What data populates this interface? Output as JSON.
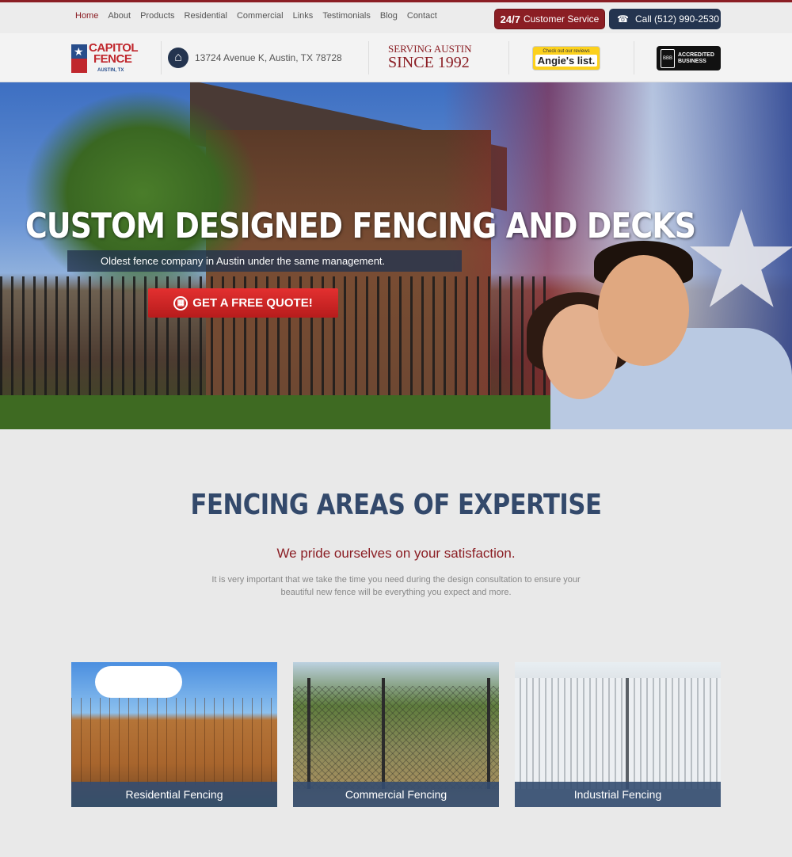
{
  "nav": {
    "items": [
      "Home",
      "About",
      "Products",
      "Residential",
      "Commercial",
      "Links",
      "Testimonials",
      "Blog",
      "Contact"
    ],
    "active": "Home"
  },
  "header": {
    "service_strong": "24/7",
    "service_label": "Customer Service",
    "call_label": "Call (512) 990-2530"
  },
  "infobar": {
    "logo_line1": "CAPITOL",
    "logo_line2": "FENCE",
    "logo_sub": "AUSTIN, TX",
    "address": "13724 Avenue K, Austin, TX 78728",
    "serving_l1": "SERVING AUSTIN",
    "serving_l2": "SINCE 1992",
    "angies_l1": "Check out our reviews",
    "angies_l2": "Angie's list.",
    "bbb_seal": "BBB",
    "bbb_text_l1": "ACCREDITED",
    "bbb_text_l2": "BUSINESS"
  },
  "hero": {
    "title": "CUSTOM DESIGNED FENCING AND DECKS",
    "subtitle": "Oldest fence company in Austin under the same management.",
    "cta": "GET A FREE QUOTE!"
  },
  "expertise": {
    "title": "FENCING AREAS OF EXPERTISE",
    "subtitle": "We pride ourselves on your satisfaction.",
    "body": "It is very important that we take the time you need during the design consultation to ensure your beautiful new fence will be everything you expect and more.",
    "cards": [
      {
        "label": "Residential Fencing"
      },
      {
        "label": "Commercial Fencing"
      },
      {
        "label": "Industrial Fencing"
      }
    ]
  },
  "colors": {
    "brand_red": "#8b1e24",
    "brand_navy": "#24344f",
    "heading_blue": "#33496b"
  },
  "icons": [
    "home-icon",
    "phone-icon",
    "star-icon",
    "calculator-icon"
  ]
}
